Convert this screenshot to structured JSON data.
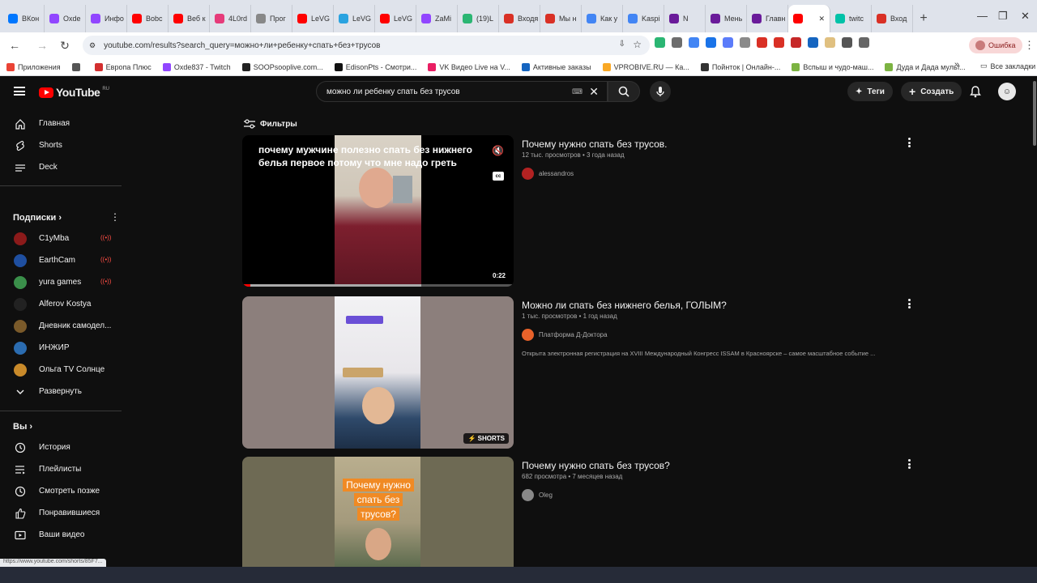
{
  "browser": {
    "tabs": [
      {
        "label": "ВКон",
        "color": "#0077ff"
      },
      {
        "label": "Oxde",
        "color": "#9146ff"
      },
      {
        "label": "Инфо",
        "color": "#9146ff"
      },
      {
        "label": "Bobc",
        "color": "#ff0000"
      },
      {
        "label": "Веб к",
        "color": "#ff0000"
      },
      {
        "label": "4L0rd",
        "color": "#e63b7a"
      },
      {
        "label": "Прог",
        "color": "#888888"
      },
      {
        "label": "LeVG",
        "color": "#ff0000"
      },
      {
        "label": "LeVG",
        "color": "#2aa3e0"
      },
      {
        "label": "LeVG",
        "color": "#ff0000"
      },
      {
        "label": "ZaMi",
        "color": "#9146ff"
      },
      {
        "label": "(19)L",
        "color": "#2bb673"
      },
      {
        "label": "Входя",
        "color": "#d93025"
      },
      {
        "label": "Мы н",
        "color": "#d93025"
      },
      {
        "label": "Как у",
        "color": "#4285f4"
      },
      {
        "label": "Kaspi",
        "color": "#4285f4"
      },
      {
        "label": "N",
        "color": "#6a1b9a"
      },
      {
        "label": "Мень",
        "color": "#6a1b9a"
      },
      {
        "label": "Главн",
        "color": "#6a1b9a"
      },
      {
        "label": "",
        "color": "#ff0000"
      },
      {
        "label": "twitc",
        "color": "#00c2a8"
      },
      {
        "label": "Вход",
        "color": "#d93025"
      }
    ],
    "url": "youtube.com/results?search_query=можно+ли+ребенку+спать+без+трусов",
    "error_label": "Ошибка",
    "bookmarks": [
      {
        "label": "Приложения",
        "color": "#ea4335"
      },
      {
        "label": "",
        "color": "#555555"
      },
      {
        "label": "Европа Плюс",
        "color": "#d32f2f"
      },
      {
        "label": "Oxde837 - Twitch",
        "color": "#9146ff"
      },
      {
        "label": "SOOPsooplive.com...",
        "color": "#222222"
      },
      {
        "label": "EdisonPts - Смотри...",
        "color": "#111111"
      },
      {
        "label": "VK Видео Live на V...",
        "color": "#e91e63"
      },
      {
        "label": "Активные заказы",
        "color": "#1565c0"
      },
      {
        "label": "VPROBIVE.RU — Ка...",
        "color": "#f9a825"
      },
      {
        "label": "Пойнток | Онлайн-...",
        "color": "#333333"
      },
      {
        "label": "Вспыш и чудо-маш...",
        "color": "#7cb342"
      },
      {
        "label": "Дуда и Дада мульт...",
        "color": "#7cb342"
      }
    ],
    "all_bookmarks": "Все закладки",
    "status_url": "https://www.youtube.com/shorts/85F7..."
  },
  "header": {
    "logo": "YouTube",
    "logo_region": "RU",
    "search_value": "можно ли ребенку спать без трусов",
    "tags_label": "Теги",
    "create_label": "Создать"
  },
  "sidebar": {
    "main": [
      {
        "label": "Главная",
        "icon": "home-icon"
      },
      {
        "label": "Shorts",
        "icon": "shorts-icon"
      },
      {
        "label": "Deck",
        "icon": "deck-icon"
      }
    ],
    "subs_title": "Подписки",
    "subs": [
      {
        "label": "C1yMba",
        "color": "#8b1a1a",
        "live": "((•))"
      },
      {
        "label": "EarthCam",
        "color": "#1f4fa0",
        "live": "((•))"
      },
      {
        "label": "yura games",
        "color": "#3a8f4a",
        "live": "((•))"
      },
      {
        "label": "Alferov Kostya",
        "color": "#222222",
        "live": ""
      },
      {
        "label": "Дневник самодел...",
        "color": "#7a5a2a",
        "live": ""
      },
      {
        "label": "ИНЖИР",
        "color": "#2b6cb0",
        "live": ""
      },
      {
        "label": "Ольга TV Солнце",
        "color": "#c98a2a",
        "live": ""
      }
    ],
    "expand_label": "Развернуть",
    "you_title": "Вы",
    "you": [
      {
        "label": "История",
        "icon": "history-icon"
      },
      {
        "label": "Плейлисты",
        "icon": "playlists-icon"
      },
      {
        "label": "Смотреть позже",
        "icon": "watch-later-icon"
      },
      {
        "label": "Понравившиеся",
        "icon": "like-icon"
      },
      {
        "label": "Ваши видео",
        "icon": "your-videos-icon"
      }
    ]
  },
  "filters_label": "Фильтры",
  "results": [
    {
      "title": "Почему нужно спать без трусов.",
      "meta": "12 тыс. просмотров • 3 года назад",
      "channel": "alessandros",
      "channel_color": "#b22222",
      "description": "",
      "duration": "0:22",
      "caption": "почему мужчине полезно спать без нижнего белья первое потому что мне надо греть",
      "badge": ""
    },
    {
      "title": "Можно ли спать без нижнего белья, ГОЛЫМ?",
      "meta": "1 тыс. просмотров • 1 год назад",
      "channel": "Платформа Д-Доктора",
      "channel_color": "#e8622a",
      "description": "Открыта электронная регистрация на XVIII Международный Конгресс ISSAM в Красноярске – самое масштабное событие ...",
      "duration": "",
      "caption": "",
      "badge": "SHORTS"
    },
    {
      "title": "Почему нужно спать без трусов?",
      "meta": "682 просмотра • 7 месяцев назад",
      "channel": "Oleg",
      "channel_color": "#888888",
      "description": "",
      "duration": "",
      "caption": "Почему нужно спать без трусов?",
      "badge": ""
    }
  ]
}
